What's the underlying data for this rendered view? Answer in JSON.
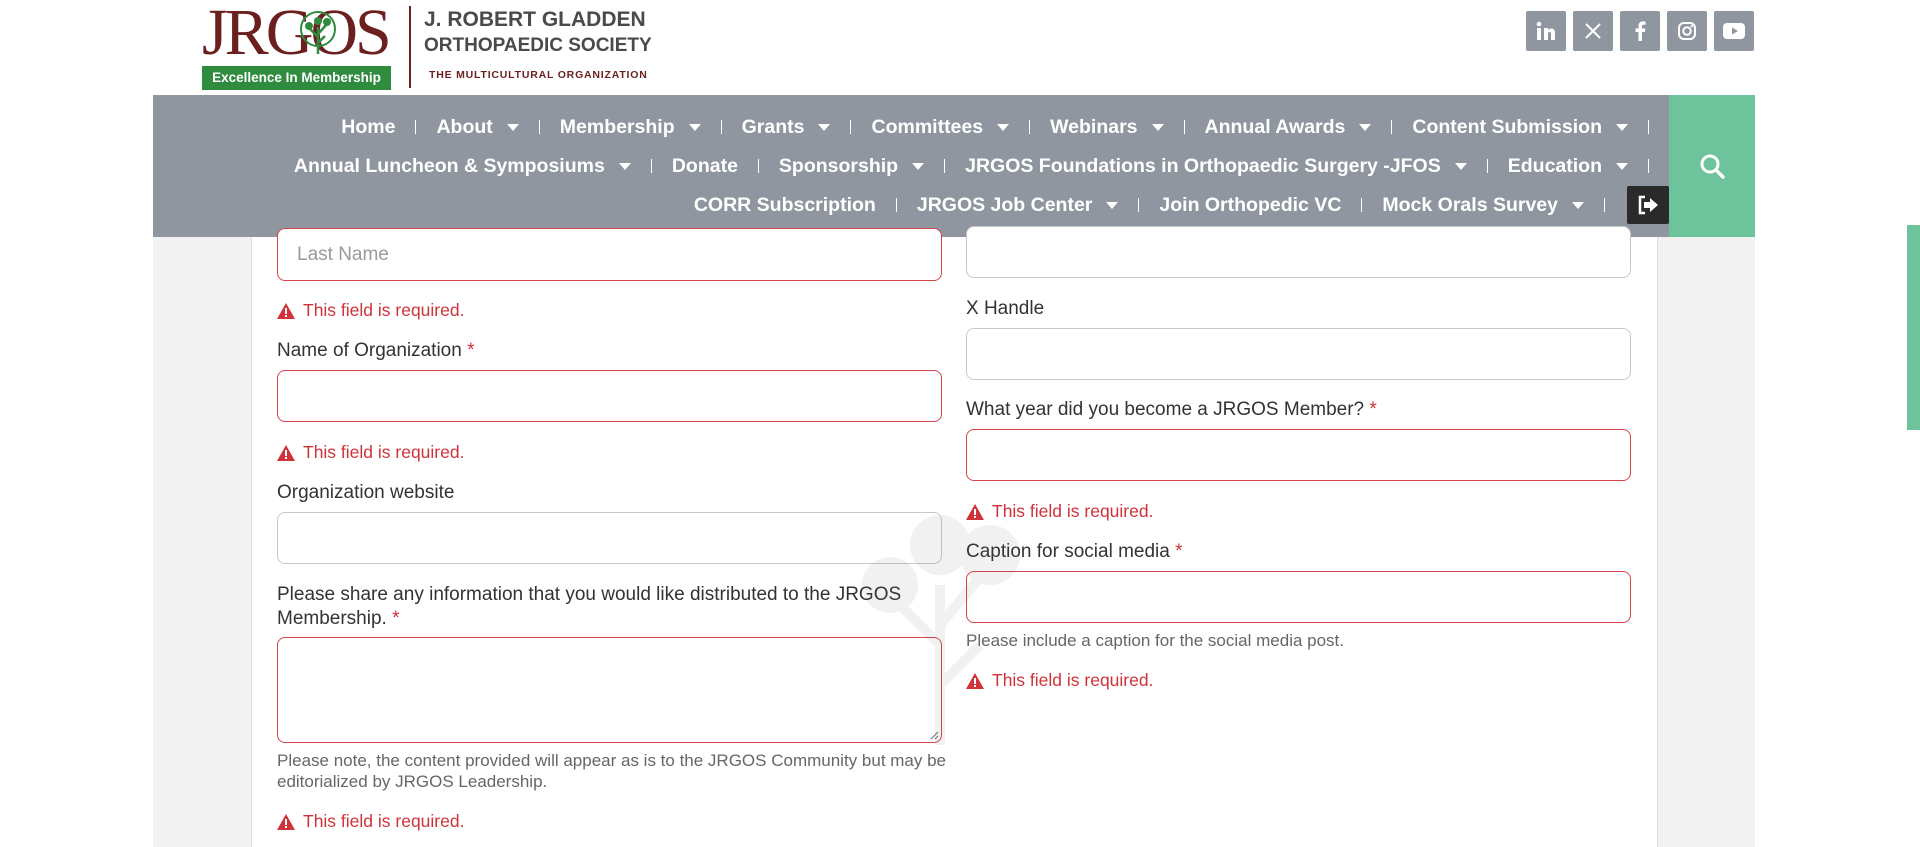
{
  "header": {
    "logo_letters": "JRGOS",
    "logo_badge": "Excellence In Membership",
    "org_line1": "J. ROBERT GLADDEN",
    "org_line2": "ORTHOPAEDIC SOCIETY",
    "org_line3": "THE MULTICULTURAL ORGANIZATION",
    "social_icons": [
      "linkedin-icon",
      "x-icon",
      "facebook-icon",
      "instagram-icon",
      "youtube-icon"
    ]
  },
  "nav": {
    "row1": [
      {
        "label": "Home",
        "has_caret": false
      },
      {
        "label": "About",
        "has_caret": true
      },
      {
        "label": "Membership",
        "has_caret": true
      },
      {
        "label": "Grants",
        "has_caret": true
      },
      {
        "label": "Committees",
        "has_caret": true
      },
      {
        "label": "Webinars",
        "has_caret": true
      },
      {
        "label": "Annual Awards",
        "has_caret": true
      },
      {
        "label": "Content Submission",
        "has_caret": true
      }
    ],
    "row2": [
      {
        "label": "Annual Luncheon & Symposiums",
        "has_caret": true
      },
      {
        "label": "Donate",
        "has_caret": false
      },
      {
        "label": "Sponsorship",
        "has_caret": true
      },
      {
        "label": "JRGOS Foundations in Orthopaedic Surgery -JFOS",
        "has_caret": true
      },
      {
        "label": "Education",
        "has_caret": true
      }
    ],
    "row3": [
      {
        "label": "CORR Subscription",
        "has_caret": false
      },
      {
        "label": "JRGOS Job Center",
        "has_caret": true
      },
      {
        "label": "Join Orthopedic VC",
        "has_caret": false
      },
      {
        "label": "Mock Orals Survey",
        "has_caret": true
      }
    ]
  },
  "form": {
    "last_name": {
      "placeholder": "Last Name",
      "error": "This field is required."
    },
    "org_name": {
      "label": "Name of Organization",
      "required": "*",
      "error": "This field is required."
    },
    "org_website": {
      "label": "Organization website"
    },
    "share_info": {
      "label": "Please share any information that you would like distributed to the JRGOS Membership.",
      "required": "*",
      "hint": "Please note, the content provided will appear as is to the JRGOS Community but may be editorialized by JRGOS Leadership.",
      "error": "This field is required."
    },
    "x_handle": {
      "label": "X Handle"
    },
    "member_year": {
      "label": "What year did you become a JRGOS Member?",
      "required": "*",
      "error": "This field is required."
    },
    "caption": {
      "label": "Caption for social media",
      "required": "*",
      "hint": "Please include a caption for the social media post.",
      "error": "This field is required."
    }
  },
  "colors": {
    "nav_bg": "#8f969f",
    "accent_green": "#6cc39c",
    "error_red": "#d0323a",
    "brand_maroon": "#6b1f1f",
    "badge_green": "#2f8b3e"
  }
}
